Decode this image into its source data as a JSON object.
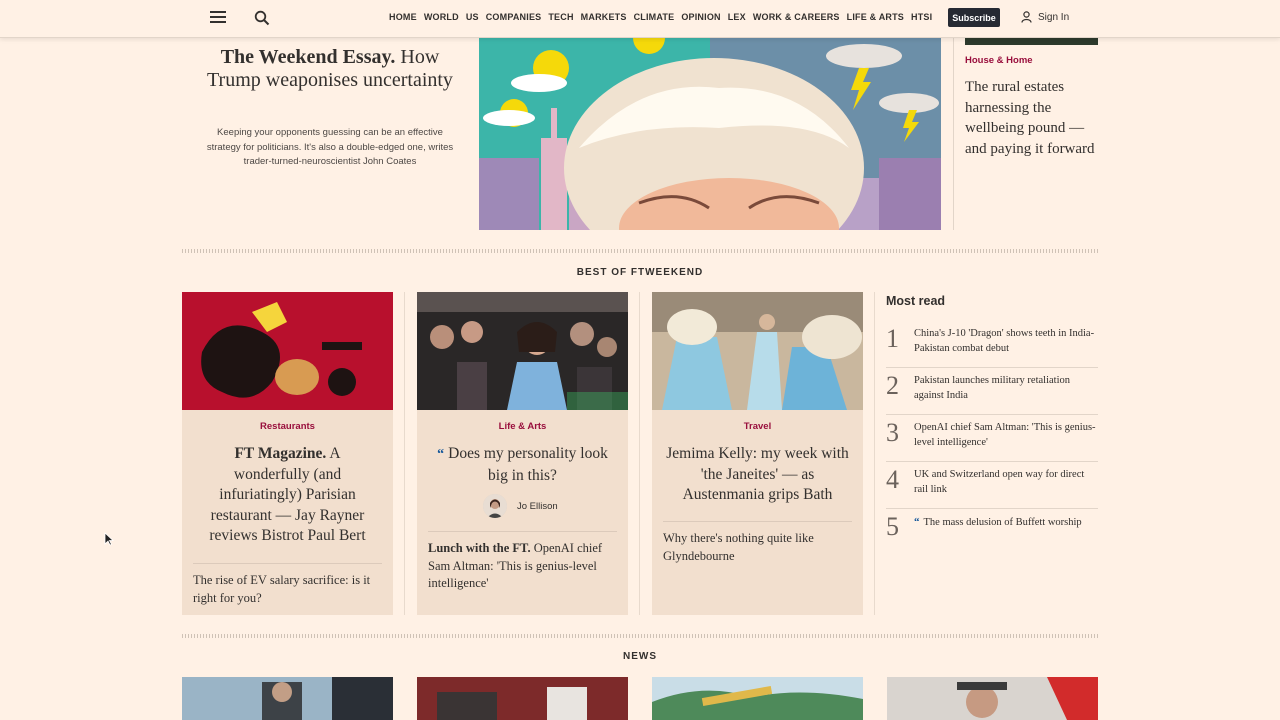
{
  "nav": {
    "links": [
      "HOME",
      "WORLD",
      "US",
      "COMPANIES",
      "TECH",
      "MARKETS",
      "CLIMATE",
      "OPINION",
      "LEX",
      "WORK & CAREERS",
      "LIFE & ARTS",
      "HTSI"
    ],
    "subscribe": "Subscribe",
    "sign_in": "Sign In"
  },
  "feature": {
    "title_bold": "The Weekend Essay.",
    "title_rest": "How Trump weaponises uncertainty",
    "description": "Keeping your opponents guessing can be an effective strategy for politicians. It's also a double-edged one, writes trader-turned-neuroscientist John Coates"
  },
  "side_story": {
    "tag": "House & Home",
    "title": "The rural estates harnessing the wellbeing pound — and paying it forward"
  },
  "best_of": {
    "label": "BEST OF FTWEEKEND",
    "cards": [
      {
        "tag": "Restaurants",
        "title_bold": "FT Magazine.",
        "title_rest": "A wonderfully (and infuriatingly) Parisian restaurant — Jay Rayner reviews Bistrot Paul Bert",
        "sub": "The rise of EV salary sacrifice: is it right for you?"
      },
      {
        "tag": "Life & Arts",
        "quote": "“",
        "title": "Does my personality look big in this?",
        "author": "Jo Ellison",
        "sub_bold": "Lunch with the FT.",
        "sub_rest": "OpenAI chief Sam Altman: 'This is genius-level intelligence'"
      },
      {
        "tag": "Travel",
        "title": "Jemima Kelly: my week with 'the Janeites' — as Austenmania grips Bath",
        "sub": "Why there's nothing quite like Glyndebourne"
      }
    ]
  },
  "most_read": {
    "title": "Most read",
    "items": [
      {
        "num": "1",
        "text": "China's J-10 'Dragon' shows teeth in India-Pakistan combat debut"
      },
      {
        "num": "2",
        "text": "Pakistan launches military retaliation against India"
      },
      {
        "num": "3",
        "text": "OpenAI chief Sam Altman: 'This is genius-level intelligence'"
      },
      {
        "num": "4",
        "text": "UK and Switzerland open way for direct rail link"
      },
      {
        "num": "5",
        "quote": "“",
        "text": "The mass delusion of Buffett worship"
      }
    ]
  },
  "news": {
    "label": "NEWS"
  },
  "colors": {
    "background": "#fff1e5",
    "claret": "#990f3d",
    "oxford": "#0f5499",
    "card": "#f2dfce"
  }
}
